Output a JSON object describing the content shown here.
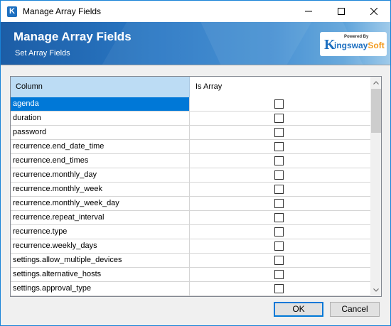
{
  "window": {
    "title": "Manage Array Fields",
    "app_icon_letter": "K",
    "controls": [
      "minimize-icon",
      "maximize-icon",
      "close-icon"
    ]
  },
  "banner": {
    "title": "Manage Array Fields",
    "subtitle": "Set Array Fields",
    "logo": {
      "powered_by": "Powered By",
      "k": "K",
      "name_main": "ingsway",
      "name_accent": "Soft"
    }
  },
  "grid": {
    "columns": [
      "Column",
      "Is Array"
    ],
    "selected_index": 0,
    "rows": [
      {
        "column": "agenda",
        "is_array": false
      },
      {
        "column": "duration",
        "is_array": false
      },
      {
        "column": "password",
        "is_array": false
      },
      {
        "column": "recurrence.end_date_time",
        "is_array": false
      },
      {
        "column": "recurrence.end_times",
        "is_array": false
      },
      {
        "column": "recurrence.monthly_day",
        "is_array": false
      },
      {
        "column": "recurrence.monthly_week",
        "is_array": false
      },
      {
        "column": "recurrence.monthly_week_day",
        "is_array": false
      },
      {
        "column": "recurrence.repeat_interval",
        "is_array": false
      },
      {
        "column": "recurrence.type",
        "is_array": false
      },
      {
        "column": "recurrence.weekly_days",
        "is_array": false
      },
      {
        "column": "settings.allow_multiple_devices",
        "is_array": false
      },
      {
        "column": "settings.alternative_hosts",
        "is_array": false
      },
      {
        "column": "settings.approval_type",
        "is_array": false
      }
    ]
  },
  "buttons": {
    "ok": "OK",
    "cancel": "Cancel"
  },
  "colors": {
    "accent": "#0078d7",
    "header_selected": "#bcdcf4",
    "banner": "#2a78c4",
    "logo_blue": "#1d6fc0",
    "logo_orange": "#f39a1e"
  }
}
